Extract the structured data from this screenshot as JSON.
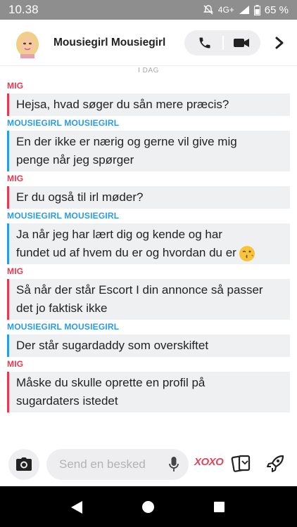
{
  "status_bar": {
    "time": "10.38",
    "network": "4G+",
    "battery": "65 %"
  },
  "header": {
    "contact_name": "Mousiegirl Mousiegirl",
    "avatar_icon": "bitmoji-avatar",
    "call_icon": "phone-icon",
    "video_icon": "video-camera-icon",
    "next_icon": "chevron-right-icon"
  },
  "messages": {
    "day_label": "I DAG",
    "thread": [
      {
        "sender": "MIG",
        "from": "me",
        "lines": [
          "Hejsa, hvad søger du sån mere præcis?"
        ]
      },
      {
        "sender": "MOUSIEGIRL MOUSIEGIRL",
        "from": "them",
        "lines": [
          "En der ikke er nærig og gerne vil give mig",
          "penge når jeg spørger"
        ]
      },
      {
        "sender": "MIG",
        "from": "me",
        "lines": [
          "Er du også til irl møder?"
        ]
      },
      {
        "sender": "MOUSIEGIRL MOUSIEGIRL",
        "from": "them",
        "lines": [
          "Ja når jeg har lært dig og kende og har",
          "fundet ud af hvem du er og hvordan du er"
        ],
        "emoji": "kissing-face-icon"
      },
      {
        "sender": "MIG",
        "from": "me",
        "lines": [
          "Så når der står Escort I din annonce så passer",
          "det jo faktisk ikke"
        ]
      },
      {
        "sender": "MOUSIEGIRL MOUSIEGIRL",
        "from": "them",
        "lines": [
          "Der står sugardaddy som overskiftet"
        ]
      },
      {
        "sender": "MIG",
        "from": "me",
        "lines": [
          "Måske du skulle oprette en profil på",
          "sugardaters istedet"
        ]
      }
    ]
  },
  "input_bar": {
    "placeholder": "Send en besked",
    "bitmoji_label": "XOXO",
    "camera_icon": "camera-icon",
    "mic_icon": "microphone-icon",
    "cards_icon": "cards-icon",
    "rocket_icon": "rocket-icon"
  },
  "colors": {
    "me": "#e8384f",
    "them": "#2a9be6",
    "bubble_bg": "#eff0f2"
  }
}
